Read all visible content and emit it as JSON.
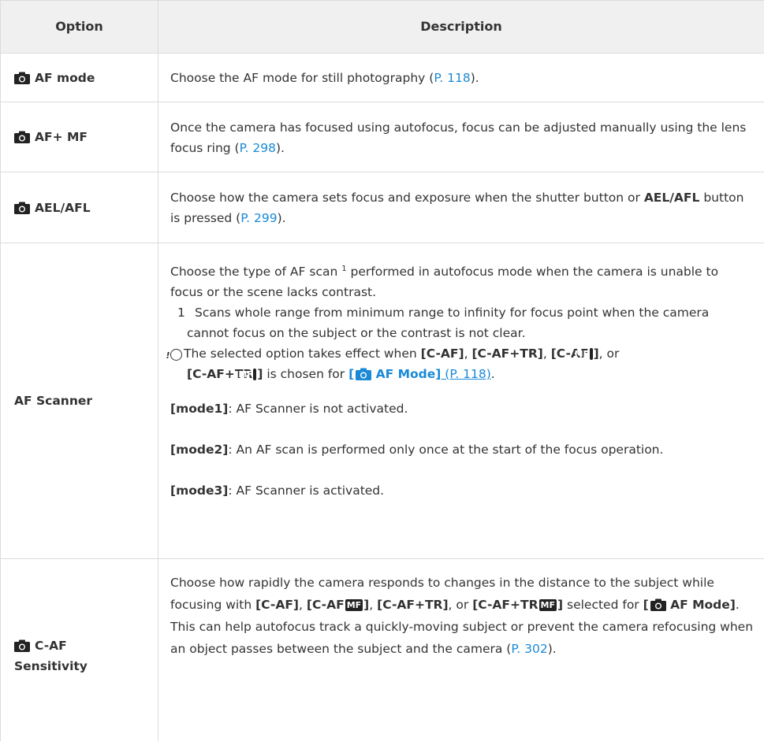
{
  "header": {
    "option": "Option",
    "description": "Description"
  },
  "rows": [
    {
      "option": "AF mode",
      "d1": "Choose the AF mode for still photography (",
      "link": "P. 118",
      "d2": ")."
    },
    {
      "option": "AF+ MF",
      "d1": "Once the camera has focused using autofocus, focus can be adjusted manually using the lens focus ring (",
      "link": "P. 298",
      "d2": ")."
    },
    {
      "option": "AEL/AFL",
      "d1": "Choose how the camera sets focus and exposure when the shutter button or ",
      "bold": "AEL/AFL",
      "d2": " button is pressed (",
      "link": "P. 299",
      "d3": ")."
    },
    {
      "option": "AF Scanner",
      "intro_a": "Choose the type of AF scan",
      "sup": "1",
      "intro_b": " performed in autofocus mode when the camera is unable to focus or the scene lacks contrast.",
      "fn_num": "1",
      "fn_text": "Scans whole range from minimum range to infinity for focus point when the camera cannot focus on the subject or the contrast is not clear.",
      "note_a": "The selected option takes effect when ",
      "caf": "[C-AF]",
      "comma1": ", ",
      "caftr": "[C-AF+TR]",
      "comma2": ", ",
      "caf_mf_a": "[C-AF",
      "mf": "MF",
      "caf_mf_b": "]",
      "or": ", or",
      "caftr_mf_a": "[C-AF+TR",
      "caftr_mf_b": "]",
      "note_b": " is chosen for ",
      "af_mode_link_a": "[",
      "af_mode_link_b": " AF Mode]",
      "af_mode_page": " (P. 118)",
      "period": ".",
      "m1_label": "[mode1]",
      "m1_text": ": AF Scanner is not activated.",
      "m2_label": "[mode2]",
      "m2_text": ": An AF scan is performed only once at the start of the focus operation.",
      "m3_label": "[mode3]",
      "m3_text": ": AF Scanner is activated."
    },
    {
      "option_a": "C-AF",
      "option_b": "Sensitivity",
      "d1": "Choose how rapidly the camera responds to changes in the distance to the subject while focusing with ",
      "caf": "[C-AF]",
      "c1": ", ",
      "caf_mf_a": "[C-AF",
      "caf_mf_b": "]",
      "c2": ", ",
      "caftr": "[C-AF+TR]",
      "c3": ", or ",
      "caftr_mf_a": "[C-AF+TR",
      "caftr_mf_b": "]",
      "d2": " selected for ",
      "afm_a": "[",
      "afm_b": " AF Mode]",
      "d3": ". This can help autofocus track a quickly-moving subject or prevent the camera refocusing when an object passes between the subject and the camera (",
      "link": "P. 302",
      "d4": ")."
    }
  ],
  "mf_label": "MF",
  "icons": {
    "camera": "camera-icon",
    "note": "note-icon"
  },
  "colors": {
    "link": "#1a8ad6",
    "header_bg": "#f0f0f0",
    "border": "#dcdcdc"
  }
}
